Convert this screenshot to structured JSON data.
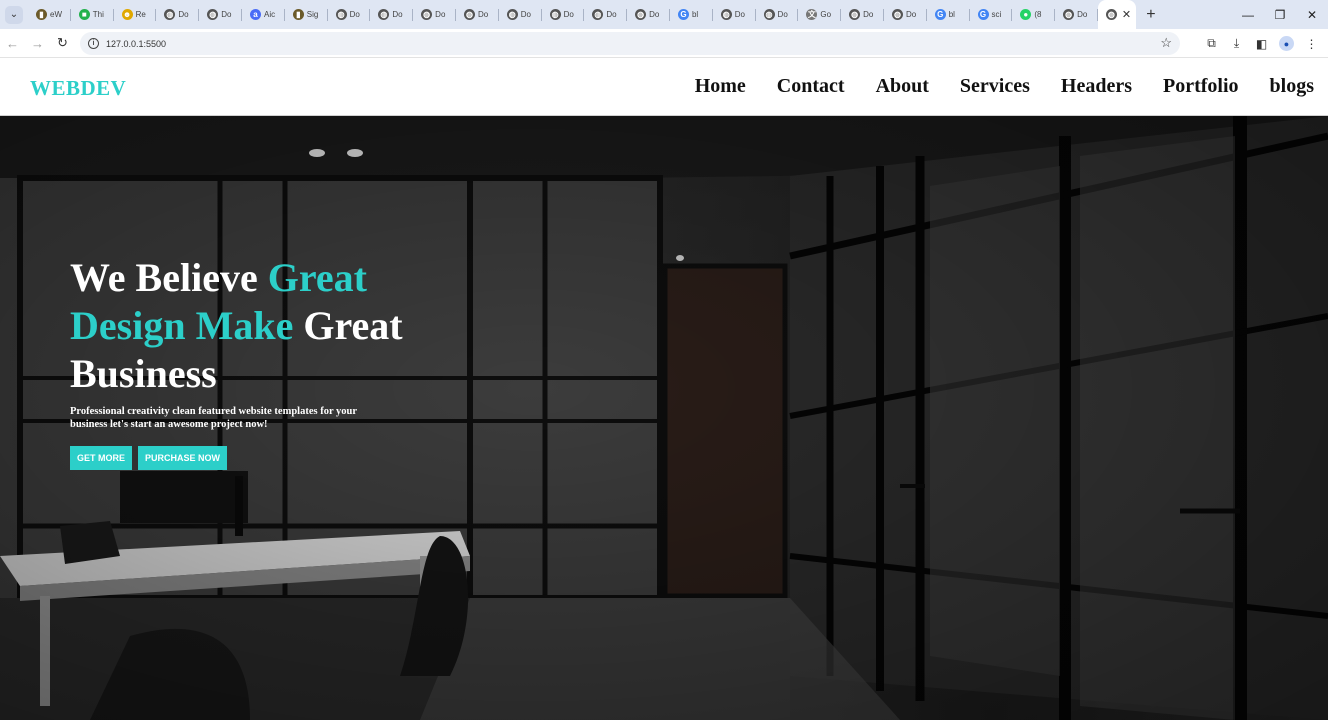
{
  "browser": {
    "tabs": [
      {
        "label": "eW",
        "icon": "bookmark-icon",
        "color": "#6b5a2a"
      },
      {
        "label": "Thi",
        "icon": "green-square-icon",
        "color": "#22b14c"
      },
      {
        "label": "Re",
        "icon": "emoji-icon",
        "color": "#e0a800"
      },
      {
        "label": "Do",
        "icon": "globe-icon",
        "color": "#555555"
      },
      {
        "label": "Do",
        "icon": "globe-icon",
        "color": "#555555"
      },
      {
        "label": "Aic",
        "icon": "a-icon",
        "color": "#4a6cf7"
      },
      {
        "label": "Sig",
        "icon": "bookmark-icon",
        "color": "#6b5a2a"
      },
      {
        "label": "Do",
        "icon": "globe-icon",
        "color": "#555555"
      },
      {
        "label": "Do",
        "icon": "globe-icon",
        "color": "#555555"
      },
      {
        "label": "Do",
        "icon": "globe-icon",
        "color": "#555555"
      },
      {
        "label": "Do",
        "icon": "globe-icon",
        "color": "#555555"
      },
      {
        "label": "Do",
        "icon": "globe-icon",
        "color": "#555555"
      },
      {
        "label": "Do",
        "icon": "globe-icon",
        "color": "#555555"
      },
      {
        "label": "Do",
        "icon": "globe-icon",
        "color": "#555555"
      },
      {
        "label": "Do",
        "icon": "globe-icon",
        "color": "#555555"
      },
      {
        "label": "bl",
        "icon": "google-icon",
        "color": "#4285f4"
      },
      {
        "label": "Do",
        "icon": "globe-icon",
        "color": "#555555"
      },
      {
        "label": "Do",
        "icon": "globe-icon",
        "color": "#555555"
      },
      {
        "label": "Go",
        "icon": "translate-icon",
        "color": "#777777"
      },
      {
        "label": "Do",
        "icon": "globe-icon",
        "color": "#555555"
      },
      {
        "label": "Do",
        "icon": "globe-icon",
        "color": "#555555"
      },
      {
        "label": "bl",
        "icon": "google-icon",
        "color": "#4285f4"
      },
      {
        "label": "sci",
        "icon": "google-icon",
        "color": "#4285f4"
      },
      {
        "label": "(8",
        "icon": "whatsapp-icon",
        "color": "#25d366"
      },
      {
        "label": "Do",
        "icon": "globe-icon",
        "color": "#555555"
      }
    ],
    "active_tab": {
      "icon": "globe-icon"
    },
    "new_tab": "+",
    "url": "127.0.0.1:5500"
  },
  "site": {
    "logo": "WEBDEV",
    "nav": [
      "Home",
      "Contact",
      "About",
      "Services",
      "Headers",
      "Portfolio",
      "blogs"
    ],
    "hero": {
      "headline_white_1": "We Believe ",
      "headline_accent_1": "Great",
      "headline_accent_2": "Design Make",
      "headline_white_2": " Great",
      "headline_white_3": "Business",
      "subtext": "Professional creativity clean featured website templates for your business let's start an awesome project now!",
      "button_primary": "GET MORE",
      "button_secondary": "PURCHASE NOW"
    },
    "colors": {
      "accent": "#2ccfc9",
      "nav_text": "#111111",
      "hero_text": "#ffffff"
    }
  }
}
